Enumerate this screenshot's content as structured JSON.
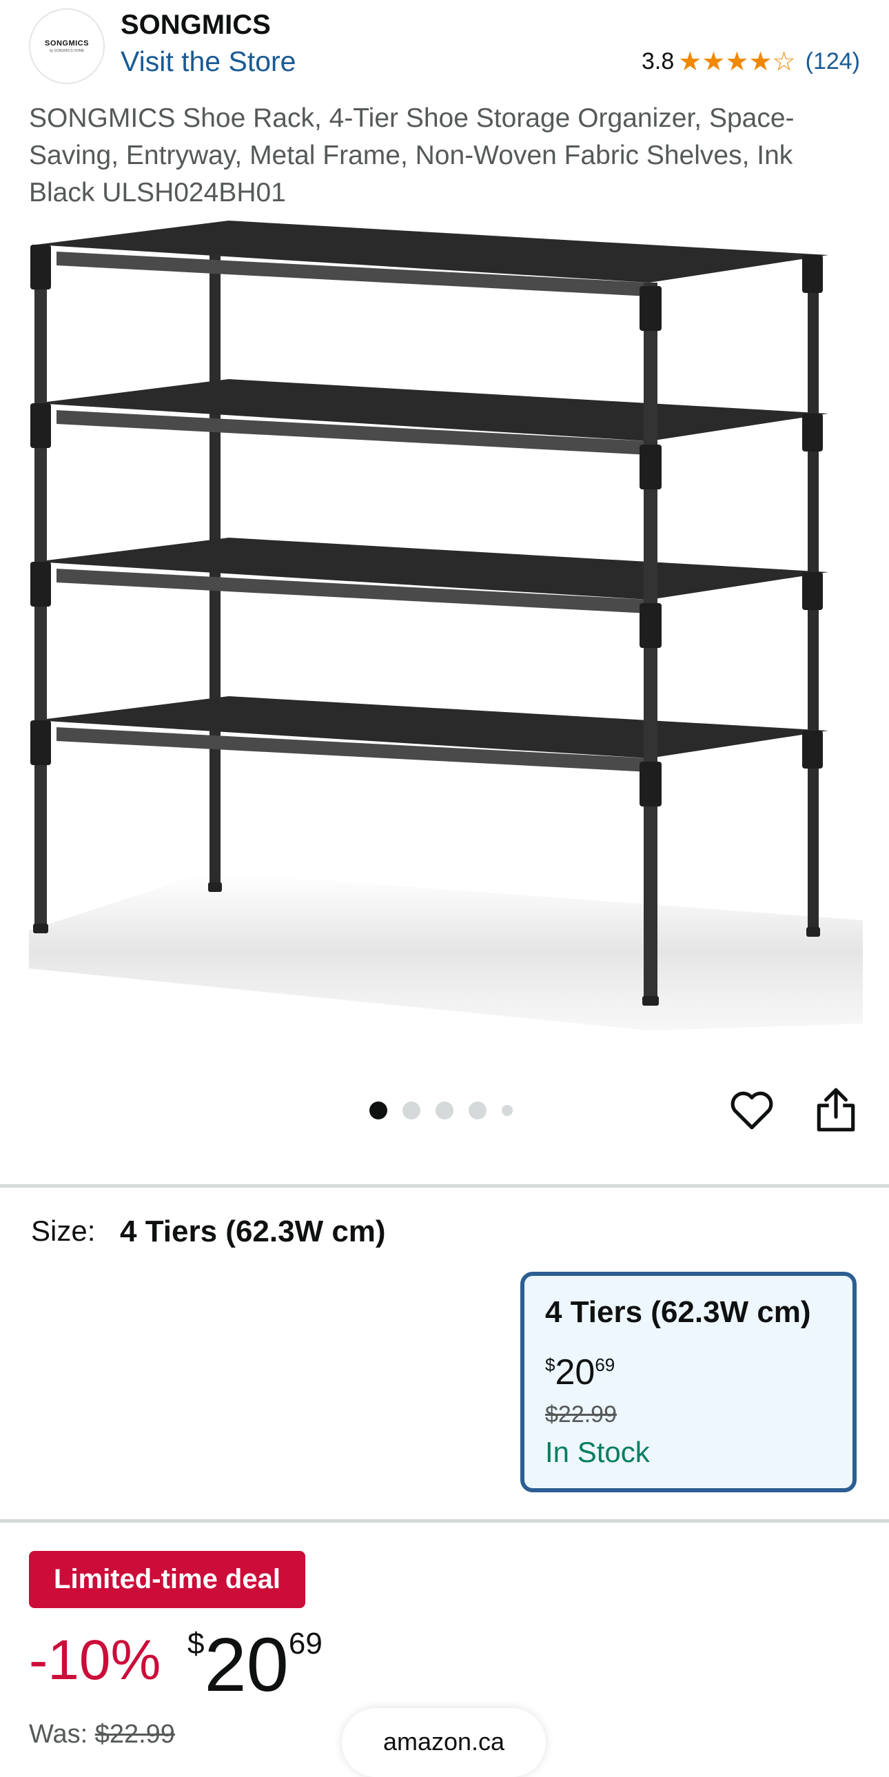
{
  "header": {
    "logo_text": "SONGMICS",
    "logo_subtext": "by SONGMICS HOME",
    "brand": "SONGMICS",
    "store_link": "Visit the Store",
    "rating": "3.8",
    "stars": 3.8,
    "rating_count": "(124)"
  },
  "product": {
    "title": "SONGMICS Shoe Rack, 4-Tier Shoe Storage Organizer, Space-Saving, Entryway, Metal Frame, Non-Woven Fabric Shelves, Ink Black ULSH024BH01"
  },
  "gallery": {
    "image_count": 5,
    "active_index": 0
  },
  "size": {
    "label": "Size:",
    "value": "4 Tiers (62.3W cm)",
    "option": {
      "name": "4 Tiers (62.3W cm)",
      "price_symbol": "$",
      "price_whole": "20",
      "price_fraction": "69",
      "was_price": "$22.99",
      "stock": "In Stock"
    }
  },
  "deal": {
    "badge": "Limited-time deal",
    "discount": "-10%",
    "price_symbol": "$",
    "price_whole": "20",
    "price_fraction": "69",
    "was_label": "Was:",
    "was_price": "$22.99"
  },
  "footer": {
    "domain": "amazon.ca"
  },
  "colors": {
    "link": "#1a5a93",
    "star": "#f08804",
    "deal_red": "#cc0c39",
    "in_stock": "#067D62",
    "selected_border": "#2d5e92"
  }
}
